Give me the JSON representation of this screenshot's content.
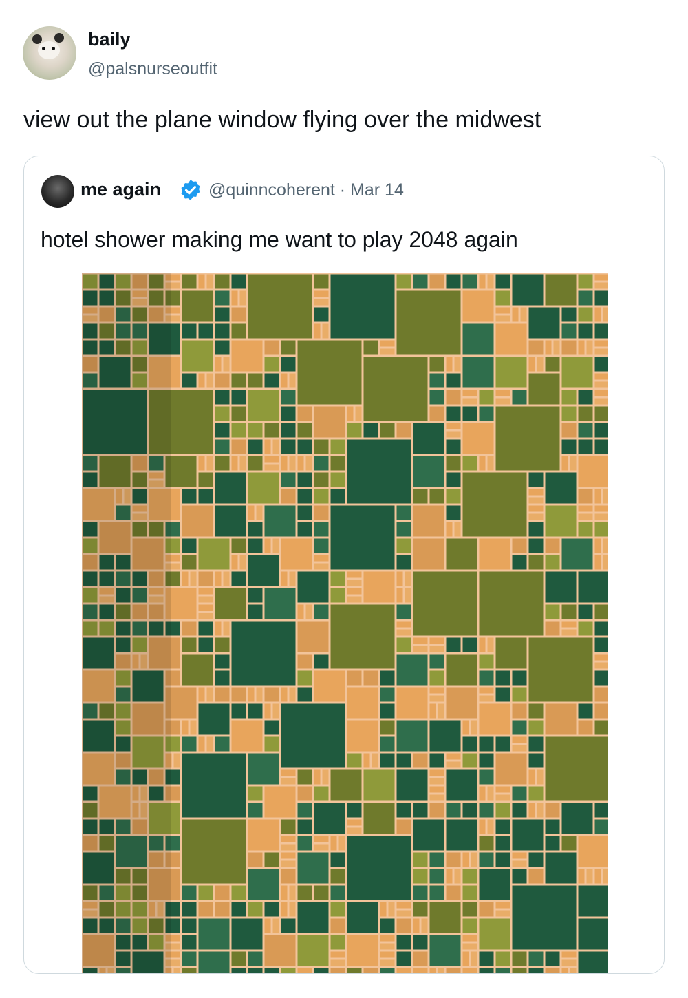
{
  "tweet": {
    "author": {
      "name": "baily",
      "handle": "@palsnurseoutfit",
      "avatar": "opossum-avatar"
    },
    "text": "view out the plane window flying over the midwest"
  },
  "quoted_tweet": {
    "author": {
      "name": "me again",
      "handle": "@quinncoherent",
      "verified": true,
      "avatar": "dark-portrait-avatar"
    },
    "meta": "@quinncoherent · Mar 14",
    "date": "Mar 14",
    "text": "hotel shower making me want to play 2048 again",
    "media": {
      "description_icon": "tiled-shower-wall-photo"
    }
  },
  "colors": {
    "tile_dark_green": "#1f5a3e",
    "tile_olive": "#6f7a2c",
    "tile_light_olive": "#8f9a3a",
    "tile_orange": "#e8a55c",
    "grout": "#f2c4a2",
    "verified_blue": "#1d9bf0",
    "secondary_text": "#536471"
  }
}
